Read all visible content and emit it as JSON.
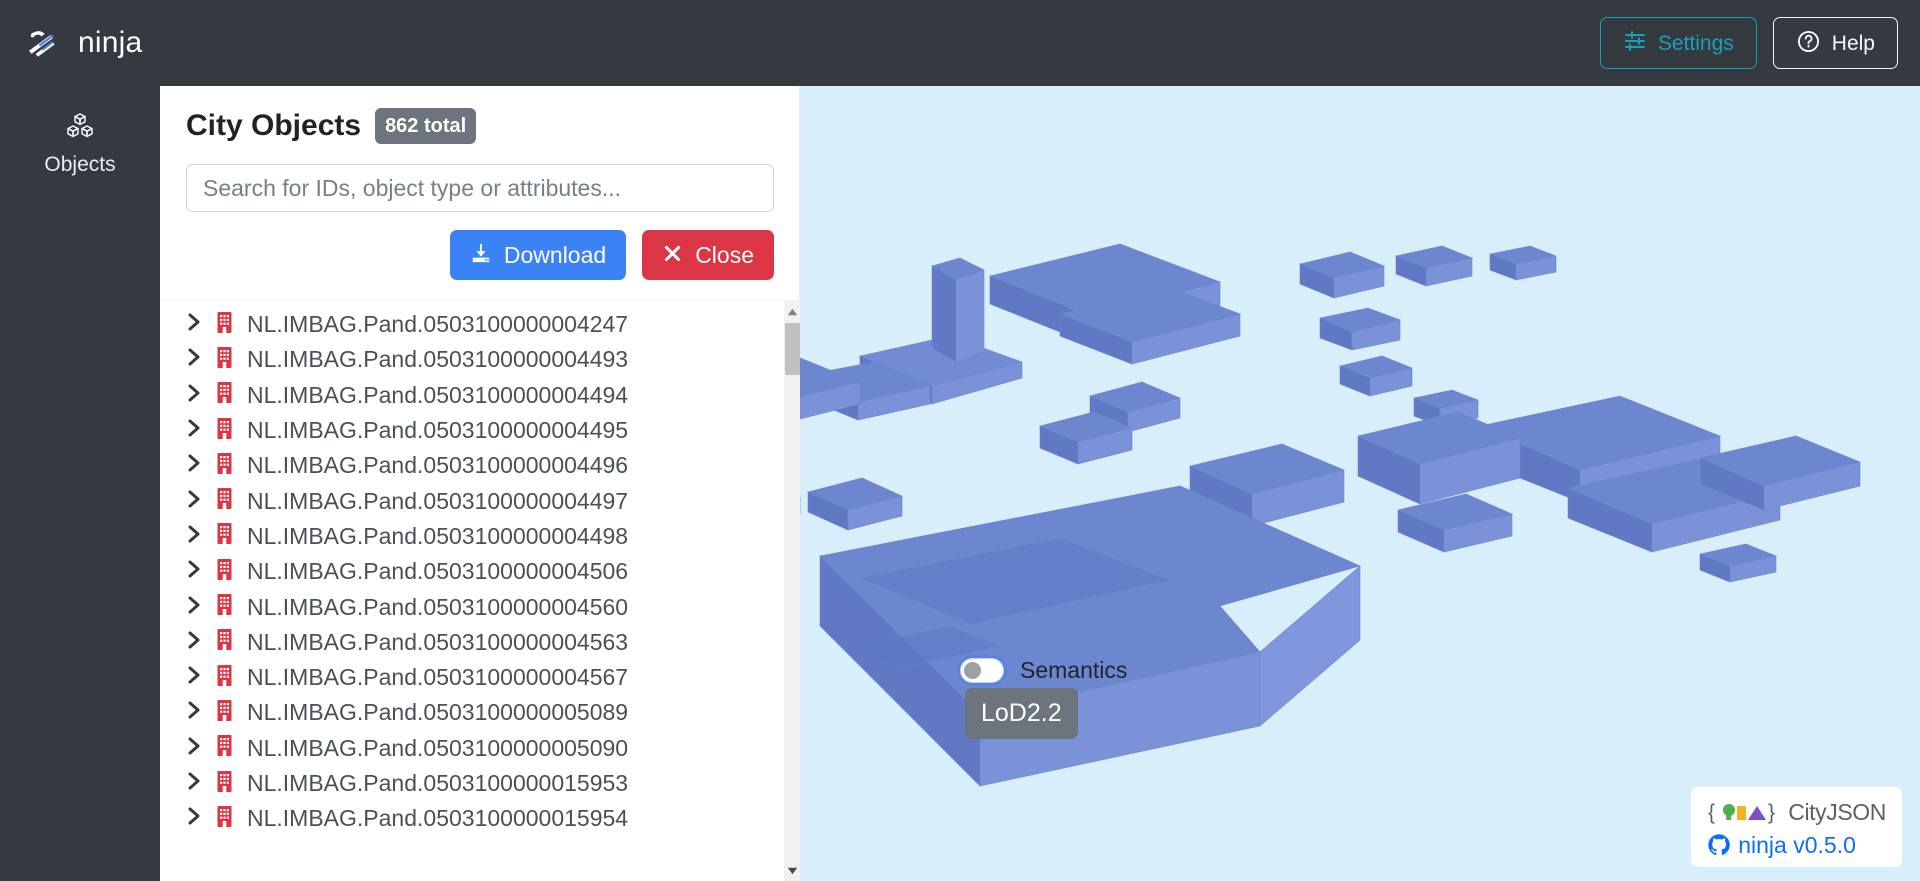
{
  "app": {
    "brand_name": "ninja",
    "brand_logo_icon": "ninja-shuriken-icon"
  },
  "navbar": {
    "settings_label": "Settings",
    "settings_icon": "sliders-icon",
    "help_label": "Help",
    "help_icon": "question-circle-icon",
    "settings_color": "#17a2b8",
    "help_color": "#f8f9fa",
    "background": "#343a40"
  },
  "sidebar": {
    "items": [
      {
        "label": "Objects",
        "icon": "cubes-icon"
      }
    ]
  },
  "panel": {
    "title": "City Objects",
    "badge": "862 total",
    "badge_color": "#6c757d",
    "search": {
      "placeholder": "Search for IDs, object type or attributes...",
      "value": "",
      "icon": "search-input"
    },
    "buttons": {
      "download_label": "Download",
      "download_icon": "download-icon",
      "download_color": "#3b82f6",
      "close_label": "Close",
      "close_icon": "times-icon",
      "close_color": "#dc3545"
    },
    "list": {
      "expand_icon": "chevron-right-icon",
      "item_icon": "building-icon",
      "item_icon_color": "#dc3545",
      "items": [
        {
          "id": "NL.IMBAG.Pand.0503100000004247"
        },
        {
          "id": "NL.IMBAG.Pand.0503100000004493"
        },
        {
          "id": "NL.IMBAG.Pand.0503100000004494"
        },
        {
          "id": "NL.IMBAG.Pand.0503100000004495"
        },
        {
          "id": "NL.IMBAG.Pand.0503100000004496"
        },
        {
          "id": "NL.IMBAG.Pand.0503100000004497"
        },
        {
          "id": "NL.IMBAG.Pand.0503100000004498"
        },
        {
          "id": "NL.IMBAG.Pand.0503100000004506"
        },
        {
          "id": "NL.IMBAG.Pand.0503100000004560"
        },
        {
          "id": "NL.IMBAG.Pand.0503100000004563"
        },
        {
          "id": "NL.IMBAG.Pand.0503100000004567"
        },
        {
          "id": "NL.IMBAG.Pand.0503100000005089"
        },
        {
          "id": "NL.IMBAG.Pand.0503100000005090"
        },
        {
          "id": "NL.IMBAG.Pand.0503100000015953"
        },
        {
          "id": "NL.IMBAG.Pand.0503100000015954"
        }
      ]
    },
    "scrollbar": {
      "up_icon": "scroll-up-arrow-icon",
      "down_icon": "scroll-down-arrow-icon",
      "thumb_icon": "scrollbar-thumb"
    }
  },
  "viewport": {
    "background_color": "#d9eefb",
    "building_color": "#6d86d0",
    "semantics": {
      "label": "Semantics",
      "enabled": false
    },
    "lod_badge": "LoD2.2",
    "credit": {
      "logo_text": "CityJSON",
      "logo_icon": "cityjson-logo-icon",
      "version_label": "ninja v0.5.0",
      "version_icon": "github-icon",
      "version_color": "#0d6efd"
    }
  }
}
